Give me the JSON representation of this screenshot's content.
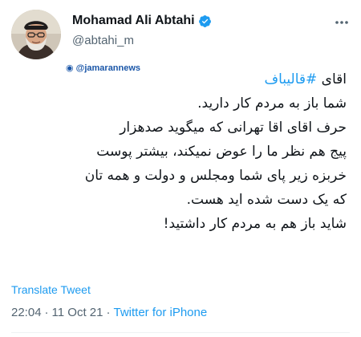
{
  "author": {
    "display_name": "Mohamad Ali Abtahi",
    "handle": "@abtahi_m",
    "verified_icon": "verified-badge-icon",
    "verified_color": "#1d9bf0"
  },
  "watermark": {
    "text": "@jamarannews"
  },
  "tweet": {
    "lines": {
      "l1_prefix": "اقای ",
      "l1_hashtag": "#قالیباف",
      "l2": "شما باز به مردم کار دارید.",
      "l3": "حرف اقای اقا تهرانی که میگوید صدهزار",
      "l4": "پیج هم نظر ما را عوض نمیکند، بیشتر پوست",
      "l5": "خربزه زیر پای شما ومجلس و دولت و همه تان",
      "l6": "که یک دست شده اید هست.",
      "l7": "شاید باز هم به مردم کار داشتید!"
    },
    "hashtag_color": "#1d9bf0"
  },
  "actions": {
    "translate_label": "Translate Tweet"
  },
  "meta": {
    "time": "22:04",
    "separator": "·",
    "date": "11 Oct 21",
    "source": "Twitter for iPhone"
  },
  "icons": {
    "more": "more-options-icon",
    "avatar": "avatar"
  }
}
